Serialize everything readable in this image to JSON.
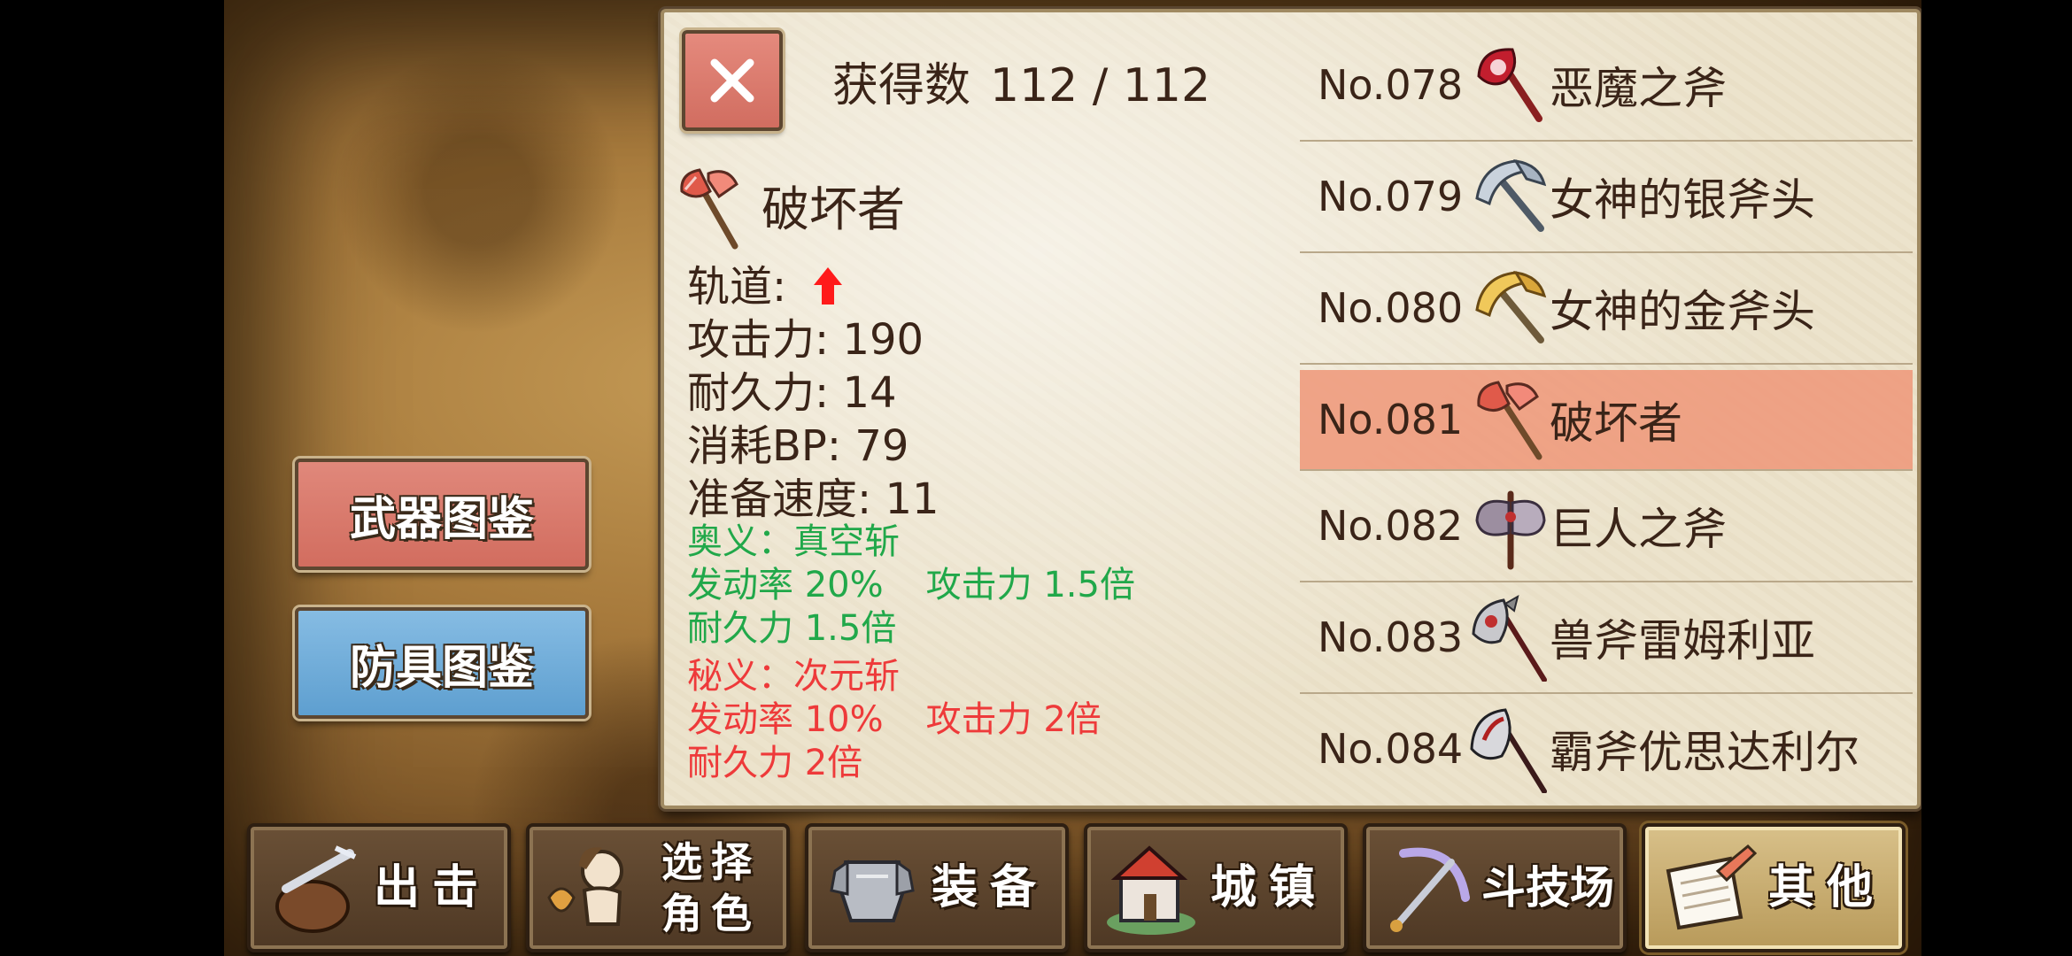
{
  "side_buttons": {
    "weapon_label": "武器图鉴",
    "armor_label": "防具图鉴"
  },
  "header": {
    "count_label": "获得数",
    "count_value": "112 / 112"
  },
  "detail": {
    "name": "破坏者",
    "icon": "battle-axe-red-icon",
    "stats": [
      {
        "label": "轨道:",
        "value": ""
      },
      {
        "label": "攻击力:",
        "value": "190"
      },
      {
        "label": "耐久力:",
        "value": "14"
      },
      {
        "label": "消耗BP:",
        "value": "79"
      },
      {
        "label": "准备速度:",
        "value": "11"
      }
    ],
    "track_icon": "up-arrow-icon",
    "ougi": {
      "title": "奥义：真空斩",
      "rate": "发动率 20%",
      "attack": "攻击力 1.5倍",
      "durability": "耐久力 1.5倍",
      "color": "#21a84a"
    },
    "higi": {
      "title": "秘义：次元斩",
      "rate": "发动率 10%",
      "attack": "攻击力 2倍",
      "durability": "耐久力 2倍",
      "color": "#ee3a3a"
    }
  },
  "list": [
    {
      "no": "No.078",
      "name": "恶魔之斧",
      "icon": "demon-axe-icon",
      "selected": false
    },
    {
      "no": "No.079",
      "name": "女神的银斧头",
      "icon": "silver-axe-icon",
      "selected": false
    },
    {
      "no": "No.080",
      "name": "女神的金斧头",
      "icon": "gold-axe-icon",
      "selected": false
    },
    {
      "no": "No.081",
      "name": "破坏者",
      "icon": "destroyer-axe-icon",
      "selected": true
    },
    {
      "no": "No.082",
      "name": "巨人之斧",
      "icon": "giant-axe-icon",
      "selected": false
    },
    {
      "no": "No.083",
      "name": "兽斧雷姆利亚",
      "icon": "beast-axe-icon",
      "selected": false
    },
    {
      "no": "No.084",
      "name": "霸斧优思达利尔",
      "icon": "overlord-axe-icon",
      "selected": false
    }
  ],
  "tabs": [
    {
      "label": "出击",
      "icon": "sortie-icon",
      "active": false
    },
    {
      "label": "选择 角色",
      "icon": "character-select-icon",
      "active": false
    },
    {
      "label": "装备",
      "icon": "equipment-icon",
      "active": false
    },
    {
      "label": "城镇",
      "icon": "town-icon",
      "active": false
    },
    {
      "label": "斗技场",
      "icon": "arena-icon",
      "active": false
    },
    {
      "label": "其他",
      "icon": "other-icon",
      "active": true
    }
  ],
  "colors": {
    "selected_row": "#ee9678",
    "weapon_button": "#d26d5f",
    "armor_button": "#5e9fd0"
  }
}
